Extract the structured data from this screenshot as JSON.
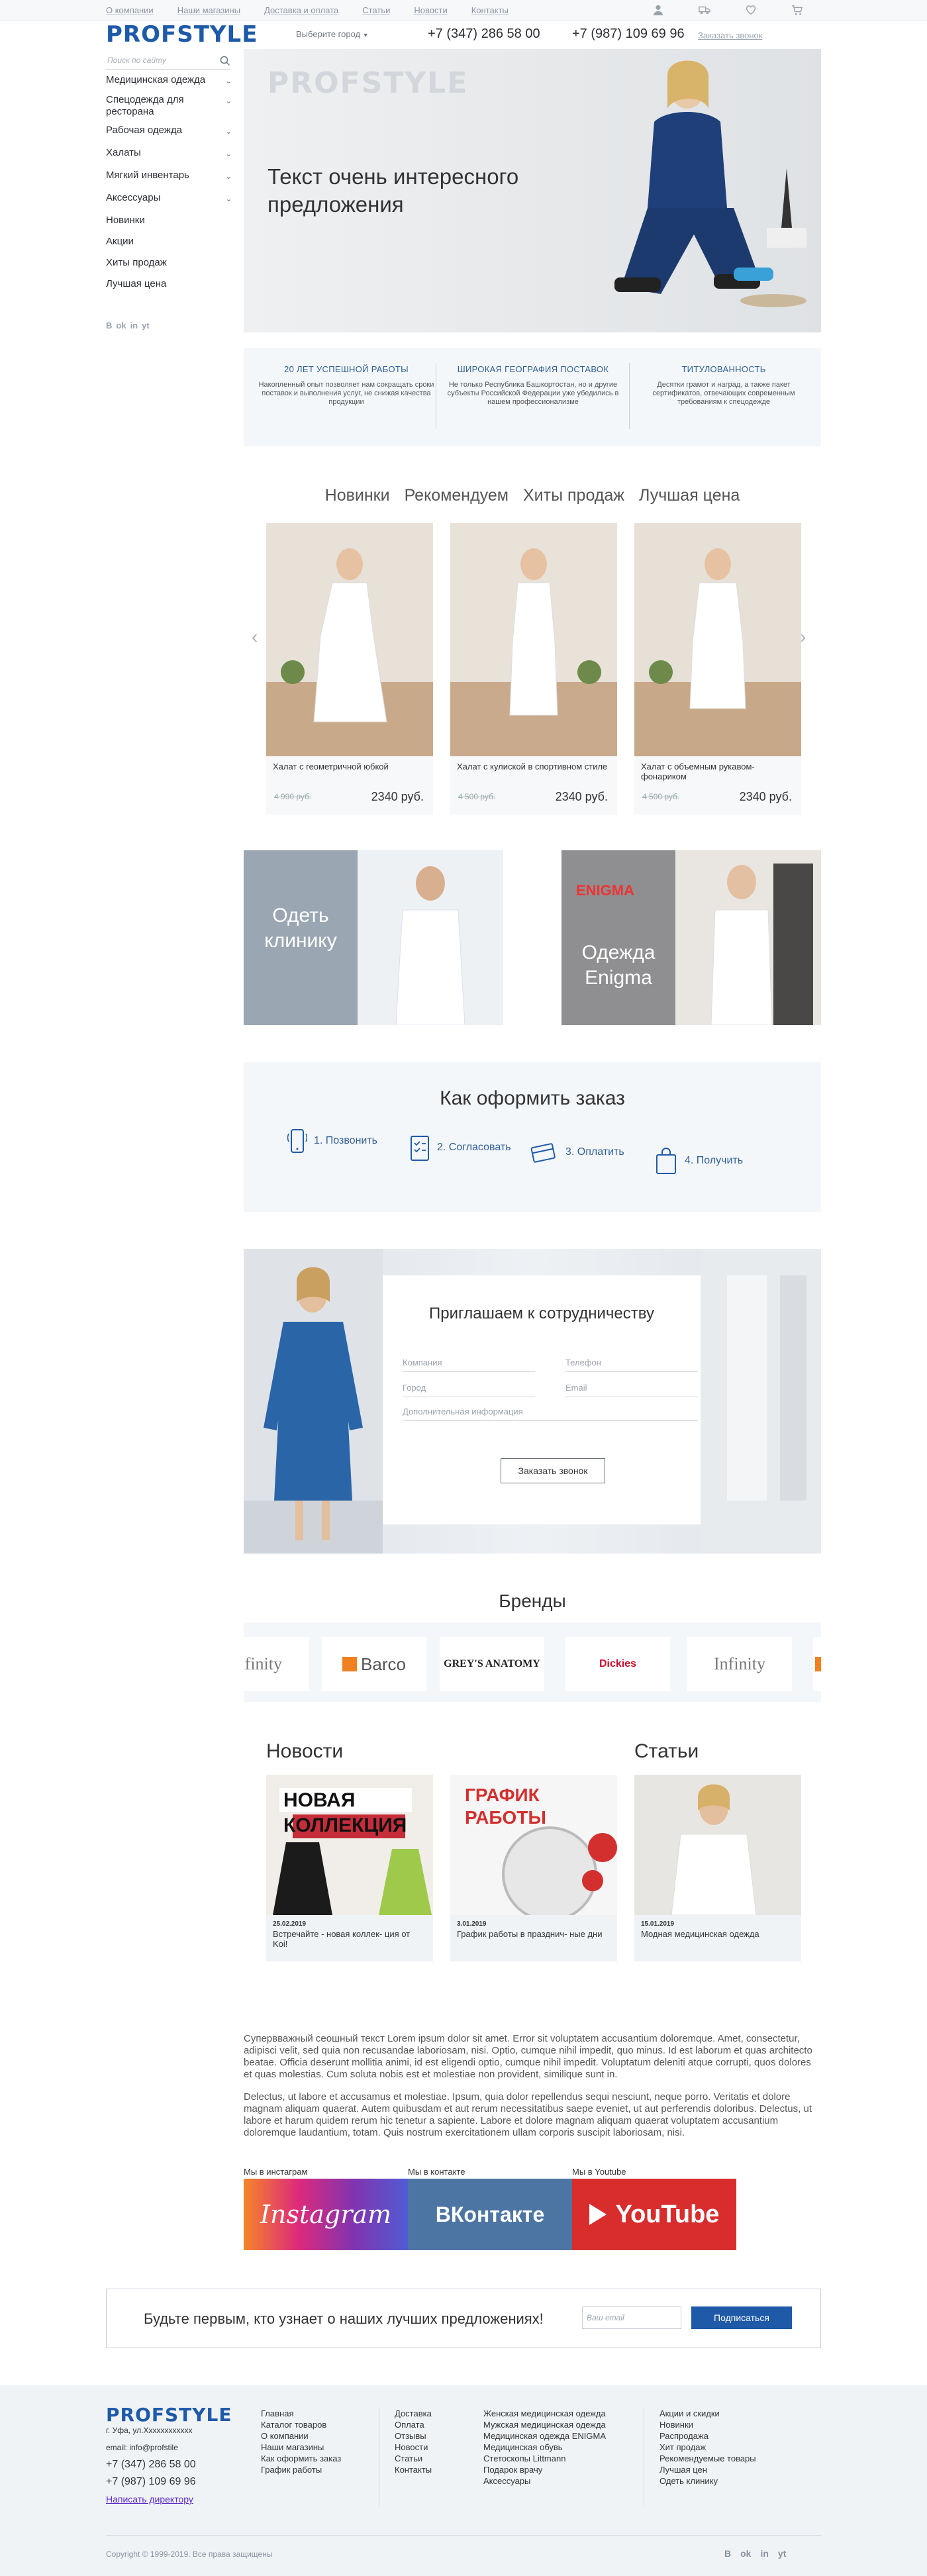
{
  "topnav": [
    "О компании",
    "Наши магазины",
    "Доставка и оплата",
    "Статьи",
    "Новости",
    "Контакты"
  ],
  "icons": {
    "user": "user-icon",
    "delivery": "truck-icon",
    "wishlist": "heart-icon",
    "cart": "cart-icon"
  },
  "header": {
    "logo": "PROFSTYLE",
    "city": "Выберите город",
    "phone1": "+7 (347) 286 58 00",
    "phone2": "+7 (987) 109 69 96",
    "callback": "Заказать звонок"
  },
  "search": {
    "placeholder": "Поиск по сайту"
  },
  "sidebar": {
    "items": [
      {
        "label": "Медицинская одежда",
        "chevron": "⌄"
      },
      {
        "label": "Спецодежда для ресторана",
        "chevron": "⌄"
      },
      {
        "label": "Рабочая одежда",
        "chevron": "⌄"
      },
      {
        "label": "Халаты",
        "chevron": "⌄"
      },
      {
        "label": "Мягкий инвентарь",
        "chevron": "⌄"
      },
      {
        "label": "Аксессуары",
        "chevron": "⌄"
      },
      {
        "label": "Новинки",
        "chevron": ""
      },
      {
        "label": "Акции",
        "chevron": ""
      },
      {
        "label": "Хиты продаж",
        "chevron": ""
      },
      {
        "label": "Лучшая цена",
        "chevron": ""
      }
    ],
    "socials": [
      "B",
      "ok",
      "in",
      "yt"
    ]
  },
  "hero": {
    "brand": "PROFSTYLE",
    "text": "Текст очень интересного предложения"
  },
  "features": [
    {
      "title": "20 лет успешной работы",
      "desc": "Накопленный опыт позволяет нам сокращать сроки поставок и выполнения услуг, не снижая качества продукции"
    },
    {
      "title": "Широкая география поставок",
      "desc": "Не только Республика Башкортостан, но и другие субъекты Российской Федерации уже убедились в нашем профессионализме"
    },
    {
      "title": "Титулованность",
      "desc": "Десятки грамот и наград, а также пакет сертификатов, отвечающих современным требованиям к спецодежде"
    }
  ],
  "tabs": [
    "Новинки",
    "Рекомендуем",
    "Хиты продаж",
    "Лучшая цена"
  ],
  "products": [
    {
      "name": "Халат с геометричной юбкой",
      "old_price": "4 990 руб.",
      "price": "2340 руб."
    },
    {
      "name": "Халат с кулиской в спортивном стиле",
      "old_price": "4 500 руб.",
      "price": "2340 руб."
    },
    {
      "name": "Халат с объемным рукавом-фонариком",
      "old_price": "4 500 руб.",
      "price": "2340 руб."
    }
  ],
  "banners": {
    "clinic": "Одеть клинику",
    "enigma_logo": "ENIGMA",
    "enigma": "Одежда Enigma"
  },
  "order": {
    "title": "Как оформить заказ",
    "steps": [
      "1. Позвонить",
      "2. Согласовать",
      "3. Оплатить",
      "4. Получить"
    ]
  },
  "coop": {
    "title": "Приглашаем к сотрудничеству",
    "fields": {
      "company": "Компания",
      "phone": "Телефон",
      "city": "Город",
      "email": "Email",
      "info": "Дополнительная информация"
    },
    "button": "Заказать звонок"
  },
  "brands": {
    "title": "Бренды",
    "items": [
      "Infinity",
      "Barco",
      "GREY'S ANATOMY",
      "Dickies",
      "Infinity"
    ]
  },
  "news": {
    "title": "Новости",
    "items": [
      {
        "date": "25.02.2019",
        "title": "Встречайте - новая коллек- ция от Koi!",
        "img_text": "НОВАЯ КОЛЛЕКЦИЯ"
      },
      {
        "date": "3.01.2019",
        "title": "График работы в празднич- ные дни",
        "img_text": "ГРАФИК РАБОТЫ"
      }
    ]
  },
  "articles": {
    "title": "Статьи",
    "items": [
      {
        "date": "15.01.2019",
        "title": "Модная медицинская одежда"
      }
    ]
  },
  "seo": [
    "Супервважный сеошный текст Lorem ipsum dolor sit amet. Error sit voluptatem accusantium doloremque. Amet, consectetur, adipisci velit, sed quia non recusandae laboriosam, nisi. Optio, cumque nihil impedit, quo minus. Id est laborum et quas architecto beatae. Officia deserunt mollitia animi, id est eligendi optio, cumque nihil impedit. Voluptatum deleniti atque corrupti, quos dolores et quas molestias. Cum soluta nobis est et molestiae non provident, similique sunt in.",
    "Delectus, ut labore et accusamus et molestiae. Ipsum, quia dolor repellendus sequi nesciunt, neque porro. Veritatis et dolore magnam aliquam quaerat. Autem quibusdam et aut rerum necessitatibus saepe eveniet, ut aut perferendis doloribus. Delectus, ut labore et harum quidem rerum hic tenetur a sapiente. Labore et dolore magnam aliquam quaerat voluptatem accusantium doloremque laudantium, totam. Quis nostrum exercitationem ullam corporis suscipit laboriosam, nisi."
  ],
  "social_blocks": [
    {
      "label": "Мы в инстаграм",
      "text": "Instagram",
      "color": "#c13584"
    },
    {
      "label": "Мы в контакте",
      "text": "ВКонтакте",
      "color": "#4c75a3"
    },
    {
      "label": "Мы в Youtube",
      "text": "YouTube",
      "color": "#d92d2d"
    }
  ],
  "subscribe": {
    "text": "Будьте первым, кто узнает о наших лучших предложениях!",
    "placeholder": "Ваш email",
    "button": "Подписаться"
  },
  "footer": {
    "logo": "PROFSTYLE",
    "address": "г. Уфа, ул.Xxxxxxxxxxxx",
    "email": "email: info@profstile",
    "phone1": "+7 (347) 286 58 00",
    "phone2": "+7 (987) 109 69 96",
    "director": "Написать директору",
    "col1": [
      "Главная",
      "Каталог товаров",
      "О компании",
      "Наши магазины",
      "Как оформить заказ",
      "График работы"
    ],
    "col2": [
      "Доставка",
      "Оплата",
      "Отзывы",
      "Новости",
      "Статьи",
      "Контакты"
    ],
    "col3": [
      "Женская медицинская одежда",
      "Мужская медицинская одежда",
      "Медицинская одежда ENIGMA",
      "Медицинская обувь",
      "Стетоскопы Littmann",
      "Подарок врачу",
      "Аксессуары"
    ],
    "col4": [
      "Акции и скидки",
      "Новинки",
      "Распродажа",
      "Хит продаж",
      "Рекомендуемые товары",
      "Лучшая цен",
      "Одеть клинику"
    ],
    "copyright": "Copyright © 1999-2019. Все права защищены"
  },
  "colors": {
    "brand": "#1e5aa8",
    "panel": "#f4f7fa",
    "text": "#333333"
  }
}
